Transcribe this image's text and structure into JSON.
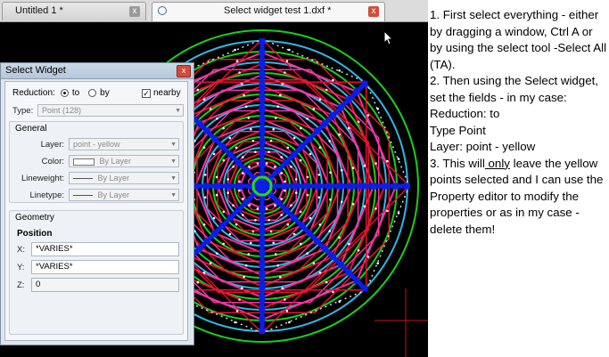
{
  "tabs": [
    {
      "title": "Untitled 1 *",
      "close": "x",
      "active": false
    },
    {
      "title": "Select widget test 1.dxf *",
      "close": "x",
      "active": true
    }
  ],
  "panel": {
    "title": "Select Widget",
    "close": "x",
    "reduction_label": "Reduction:",
    "to_label": "to",
    "by_label": "by",
    "nearby_label": "nearby",
    "nearby_checked": "✓",
    "type_label": "Type:",
    "type_value": "Point (128)",
    "general_title": "General",
    "layer_label": "Layer:",
    "layer_value": "point - yellow",
    "color_label": "Color:",
    "color_value": "By Layer",
    "lineweight_label": "Lineweight:",
    "lineweight_value": "By Layer",
    "linetype_label": "Linetype:",
    "linetype_value": "By Layer",
    "geometry_title": "Geometry",
    "position_title": "Position",
    "x_label": "X:",
    "x_value": "*VARIES*",
    "y_label": "Y:",
    "y_value": "*VARIES*",
    "z_label": "Z:",
    "z_value": "0"
  },
  "notes": {
    "p1": "1. First select everything - either by dragging a window, Ctrl A or by using the select tool -Select All (TA).",
    "p2a": "2. Then using the Select widget, set the fields - in my case:",
    "p2b": "Reduction: to",
    "p2c": "Type Point",
    "p2d": "Layer: point - yellow",
    "p3_pre": "3. This will",
    "p3_u": " only",
    "p3_post": " leave the yellow points selected and I can use the Property editor to modify the properties or as in my case - delete them!"
  },
  "colors": {
    "background": "#000000",
    "circle_green": "#19d019",
    "circle_cyan": "#2fb8e6",
    "spoke_blue": "#0a1ee8",
    "web_magenta": "#ff2fa0",
    "web_red": "#e8122f",
    "points_white": "#ffffff",
    "center_green": "#18e018"
  }
}
